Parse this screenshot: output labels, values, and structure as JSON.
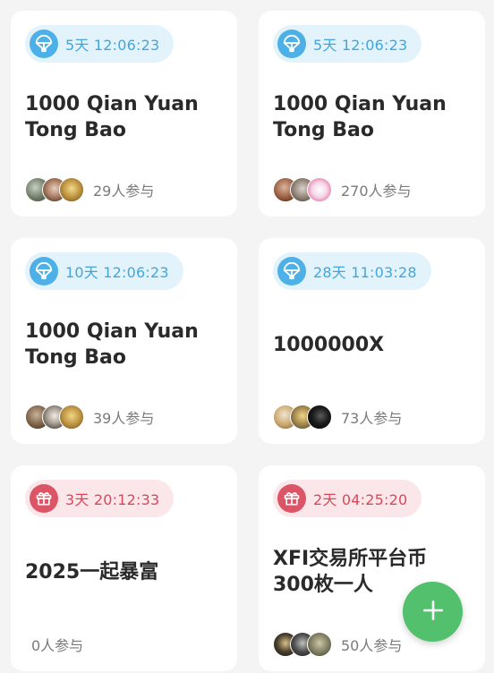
{
  "cards": [
    {
      "badge_type": "airdrop",
      "badge_text": "5天 12:06:23",
      "title": "1000 Qian Yuan Tong Bao",
      "participants": "29人参与",
      "avatars": [
        "avatar-photo",
        "avatar-photo",
        "avatar-photo"
      ]
    },
    {
      "badge_type": "airdrop",
      "badge_text": "5天 12:06:23",
      "title": "1000 Qian Yuan Tong Bao",
      "participants": "270人参与",
      "avatars": [
        "avatar-photo",
        "avatar-photo",
        "avatar-photo"
      ]
    },
    {
      "badge_type": "airdrop",
      "badge_text": "10天 12:06:23",
      "title": "1000 Qian Yuan Tong Bao",
      "participants": "39人参与",
      "avatars": [
        "avatar-photo",
        "avatar-photo",
        "avatar-photo"
      ]
    },
    {
      "badge_type": "airdrop",
      "badge_text": "28天 11:03:28",
      "title": "1000000X",
      "participants": "73人参与",
      "avatars": [
        "avatar-photo",
        "avatar-photo",
        "avatar-photo"
      ]
    },
    {
      "badge_type": "gift",
      "badge_text": "3天 20:12:33",
      "title": "2025一起暴富",
      "participants": "0人参与",
      "avatars": []
    },
    {
      "badge_type": "gift",
      "badge_text": "2天 04:25:20",
      "title": "XFI交易所平台币 300枚一人",
      "participants": "50人参与",
      "avatars": [
        "avatar-photo",
        "avatar-photo",
        "avatar-photo"
      ]
    }
  ],
  "fab": {
    "icon": "plus-icon"
  },
  "colors": {
    "airdrop_badge_bg": "#e3f3fc",
    "airdrop_accent": "#42a6dc",
    "gift_badge_bg": "#fbe7ea",
    "gift_accent": "#d9475a",
    "fab": "#52c06d"
  }
}
